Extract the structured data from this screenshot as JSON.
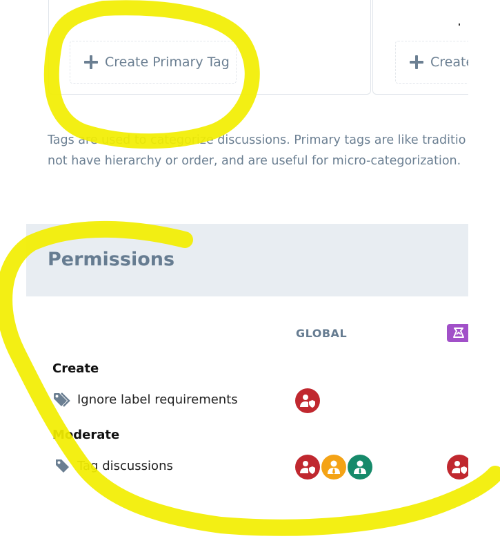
{
  "tags": {
    "create_primary_label": "Create Primary Tag",
    "create_secondary_label": "Create",
    "help_line_1": "Tags are used to categorize discussions. Primary tags are like traditio",
    "help_line_2": "not have hierarchy or order, and are useful for micro-categorization."
  },
  "permissions": {
    "title": "Permissions",
    "columns": [
      "GLOBAL"
    ],
    "groups": [
      {
        "label": "Create",
        "rows": [
          {
            "label": "Ignore label requirements",
            "icon": "tags-icon",
            "badges": [
              "admin"
            ]
          }
        ]
      },
      {
        "label": "Moderate",
        "rows": [
          {
            "label": "Tag discussions",
            "icon": "tag-icon",
            "badges": [
              "admin",
              "mod",
              "member"
            ]
          }
        ]
      }
    ]
  },
  "colors": {
    "text_muted": "#6b7f92",
    "header_bg": "#e8edf2",
    "badge_admin": "#c0282f",
    "badge_mod": "#f4a316",
    "badge_member": "#168a6a",
    "tag_chip": "#a150c8",
    "highlighter": "#f2ee00"
  }
}
